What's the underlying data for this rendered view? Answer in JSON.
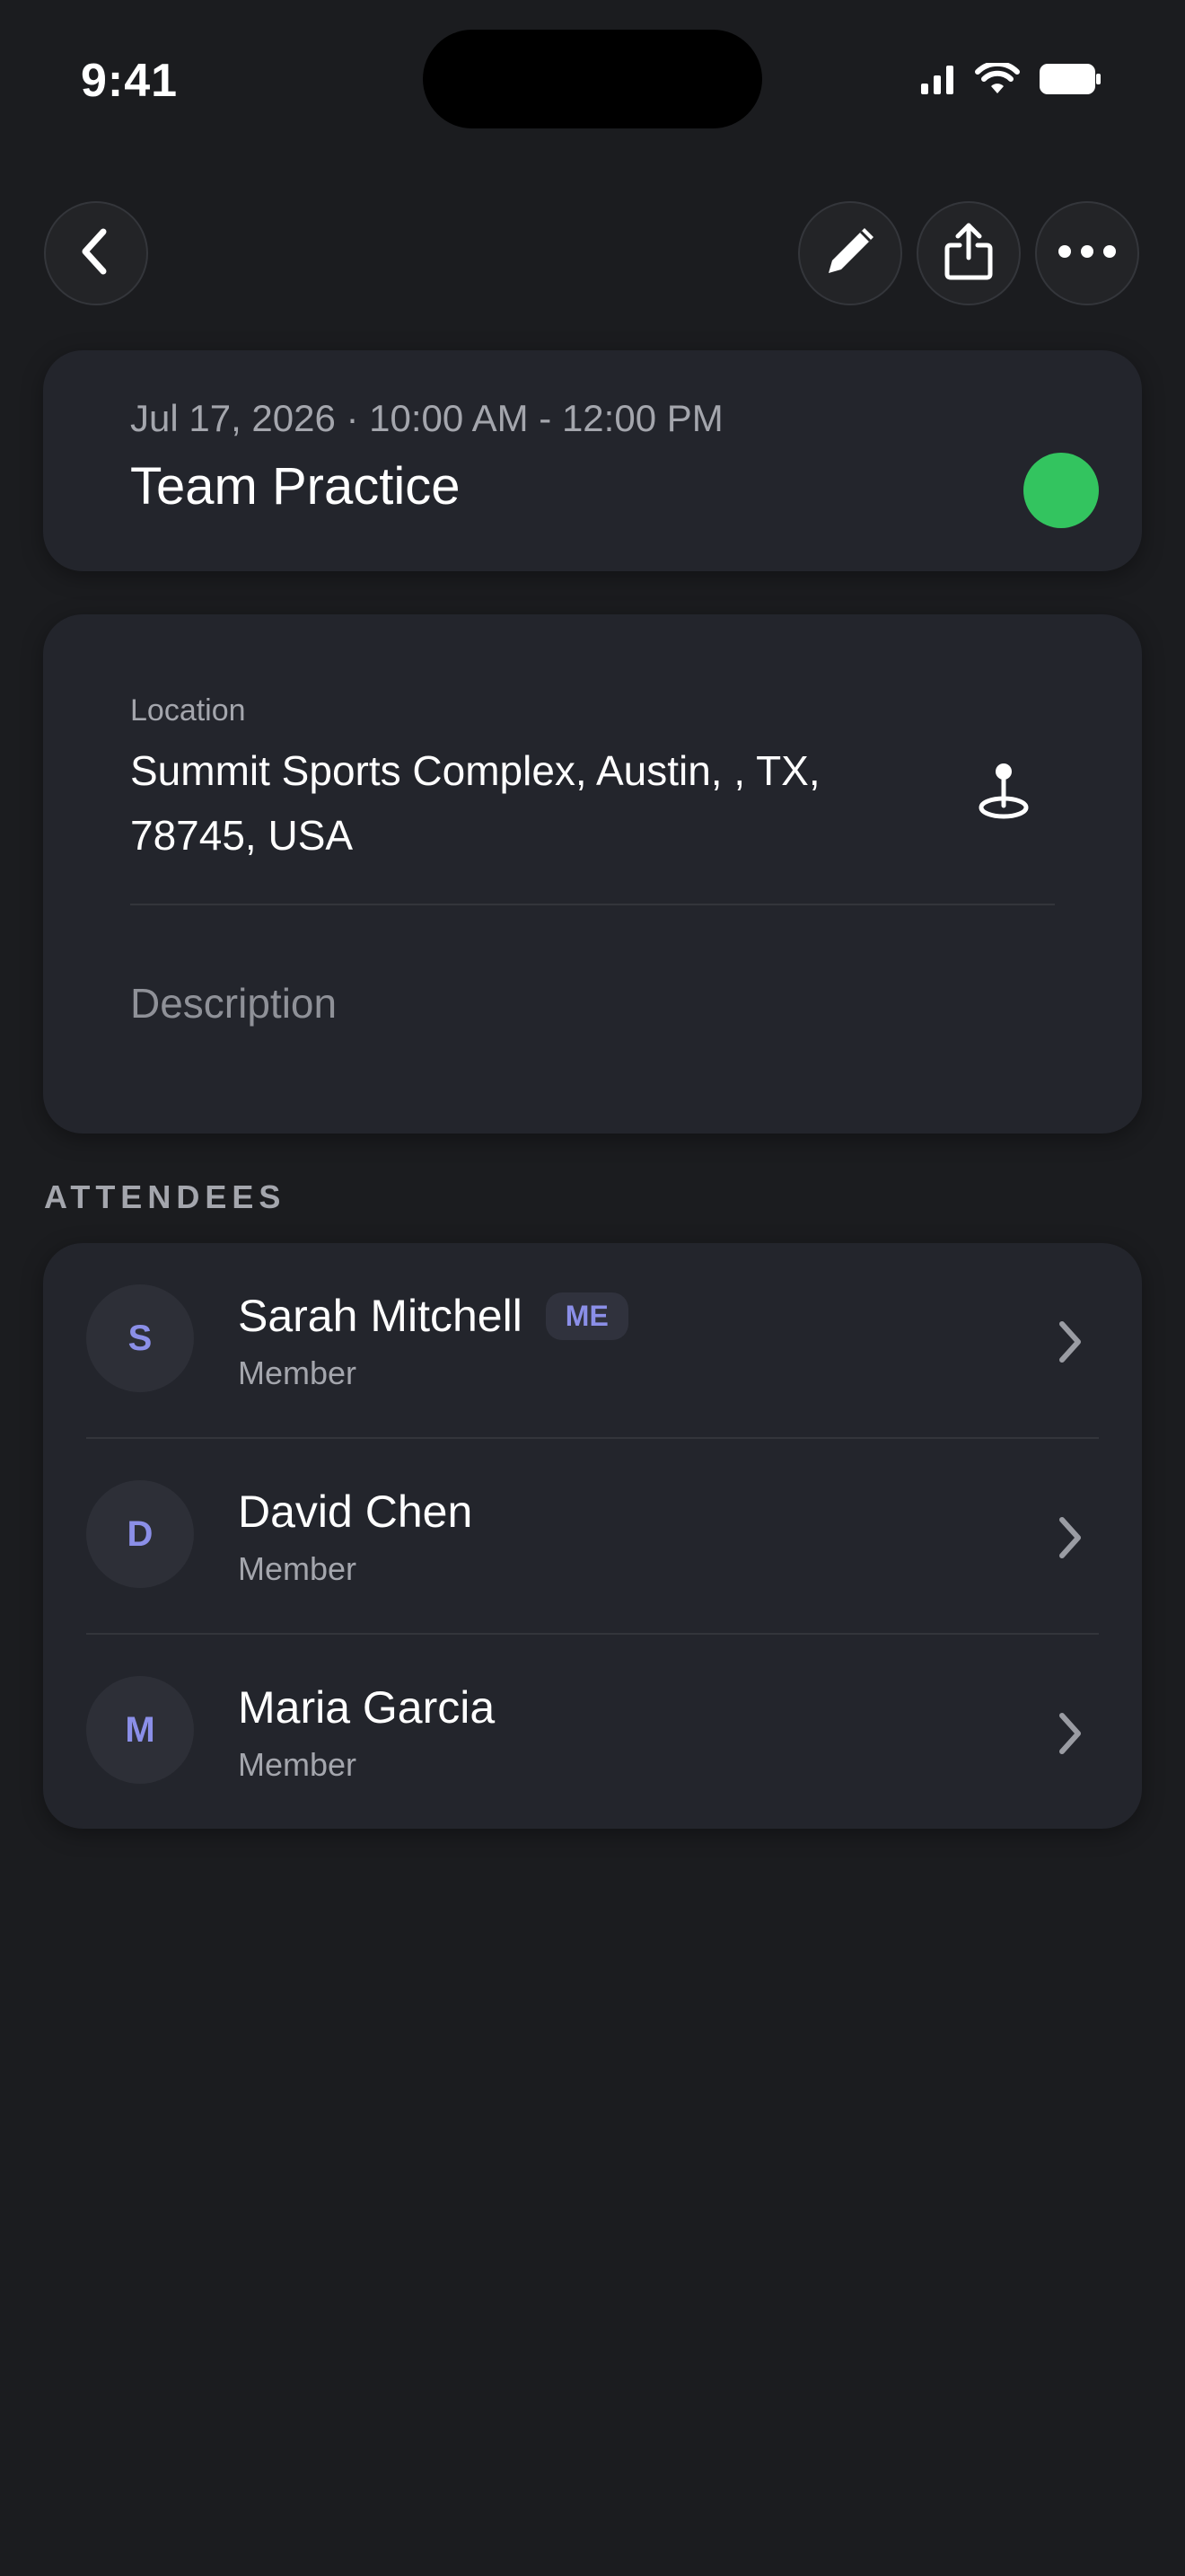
{
  "status_bar": {
    "time": "9:41"
  },
  "nav": {
    "back_icon": "chevron-left-icon",
    "edit_icon": "pencil-icon",
    "share_icon": "share-icon",
    "more_icon": "ellipsis-icon"
  },
  "event": {
    "datetime": "Jul 17, 2026 · 10:00 AM - 12:00 PM",
    "title": "Team Practice",
    "status_color": "#33c45f"
  },
  "details": {
    "location_label": "Location",
    "location_value": "Summit Sports Complex, Austin, , TX, 78745, USA",
    "description_placeholder": "Description"
  },
  "attendees": {
    "section_title": "ATTENDEES",
    "items": [
      {
        "initial": "S",
        "name": "Sarah Mitchell",
        "badge": "ME",
        "role": "Member"
      },
      {
        "initial": "D",
        "name": "David Chen",
        "badge": "",
        "role": "Member"
      },
      {
        "initial": "M",
        "name": "Maria Garcia",
        "badge": "",
        "role": "Member"
      }
    ]
  },
  "colors": {
    "background": "#1b1c1f",
    "card": "#23252c",
    "accent": "#8b8fe8",
    "status_green": "#33c45f"
  }
}
